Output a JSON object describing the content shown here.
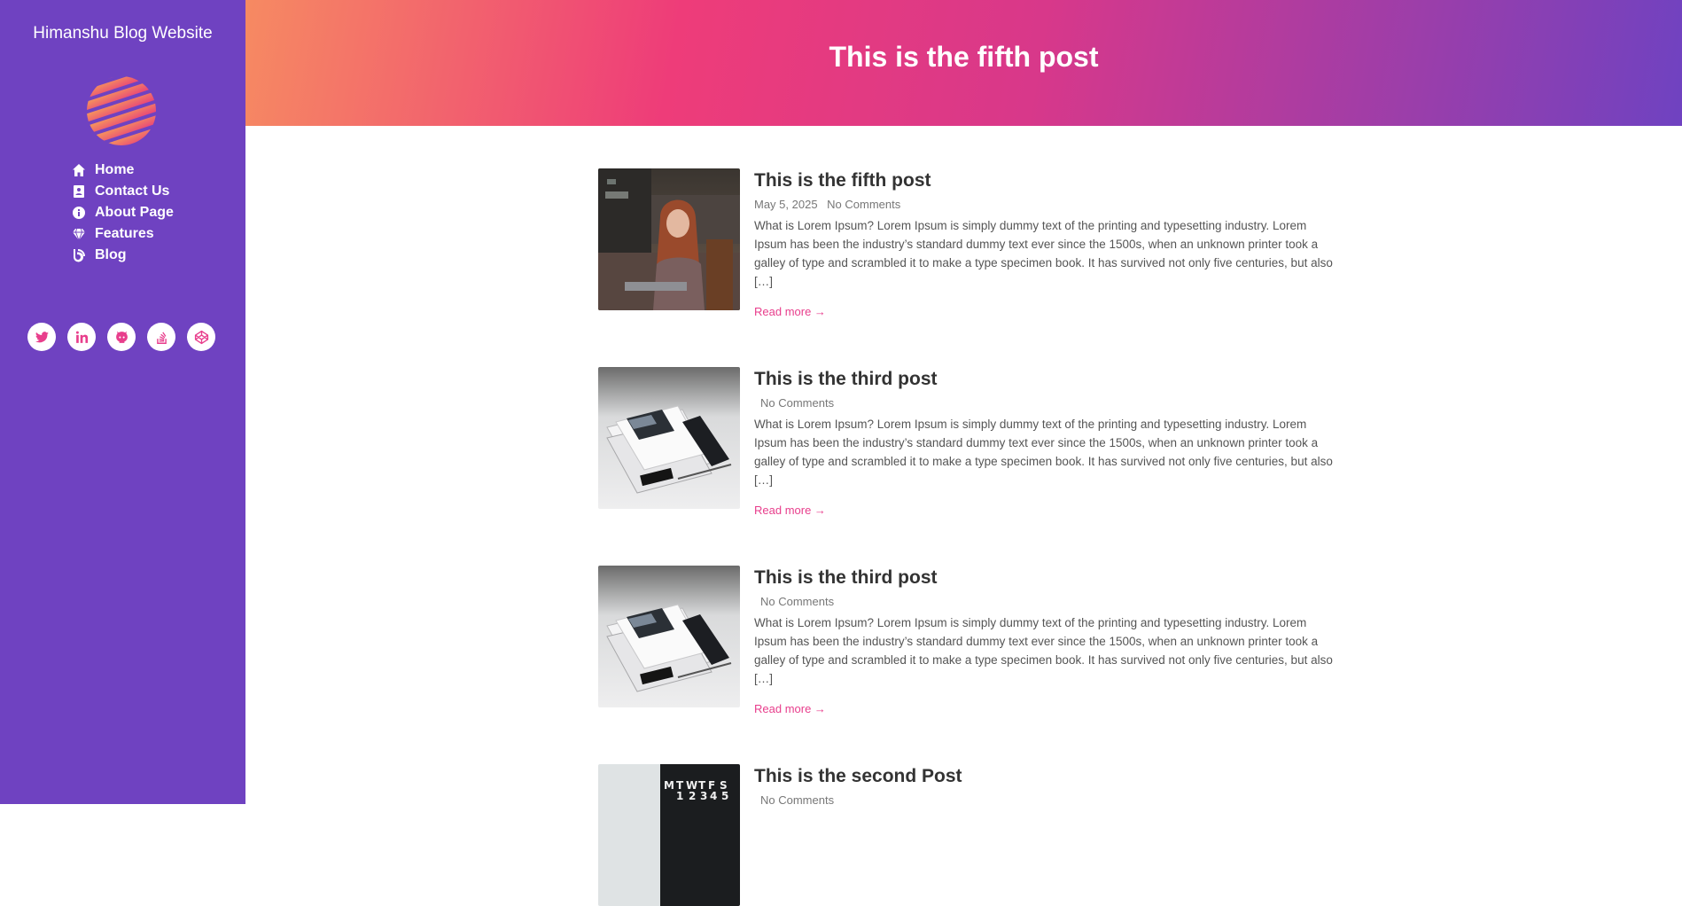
{
  "sidebar": {
    "site_title": "Himanshu Blog Website",
    "nav": [
      {
        "label": "Home",
        "icon": "home-icon"
      },
      {
        "label": "Contact Us",
        "icon": "contact-card-icon"
      },
      {
        "label": "About Page",
        "icon": "info-icon"
      },
      {
        "label": "Features",
        "icon": "diamond-icon"
      },
      {
        "label": "Blog",
        "icon": "blog-icon"
      }
    ],
    "socials": [
      "twitter-icon",
      "linkedin-icon",
      "github-icon",
      "stackoverflow-icon",
      "codepen-icon"
    ]
  },
  "header": {
    "title": "This is the fifth post"
  },
  "posts": [
    {
      "title": "This is the fifth post",
      "date": "May 5, 2025",
      "comments": "No Comments",
      "excerpt": "What is Lorem Ipsum? Lorem Ipsum is simply dummy text of the printing and typesetting industry. Lorem Ipsum has been the industry’s standard dummy text ever since the 1500s, when an unknown printer took a galley of type and scrambled it to make a type specimen book. It has survived not only five centuries, but also […]",
      "read_more": "Read more →",
      "image": "woman-laptop-image"
    },
    {
      "title": "This is the third post",
      "date": "",
      "comments": "No Comments",
      "excerpt": "What is Lorem Ipsum? Lorem Ipsum is simply dummy text of the printing and typesetting industry. Lorem Ipsum has been the industry’s standard dummy text ever since the 1500s, when an unknown printer took a galley of type and scrambled it to make a type specimen book. It has survived not only five centuries, but also […]",
      "read_more": "Read more →",
      "image": "notebook-phone-image"
    },
    {
      "title": "This is the third post",
      "date": "",
      "comments": "No Comments",
      "excerpt": "What is Lorem Ipsum? Lorem Ipsum is simply dummy text of the printing and typesetting industry. Lorem Ipsum has been the industry’s standard dummy text ever since the 1500s, when an unknown printer took a galley of type and scrambled it to make a type specimen book. It has survived not only five centuries, but also […]",
      "read_more": "Read more →",
      "image": "notebook-phone-image"
    },
    {
      "title": "This is the second Post",
      "date": "",
      "comments": "No Comments",
      "image": "calendar-image"
    }
  ],
  "colors": {
    "sidebar": "#6f42c1",
    "accent": "#e83e8c",
    "text": "#333333"
  }
}
